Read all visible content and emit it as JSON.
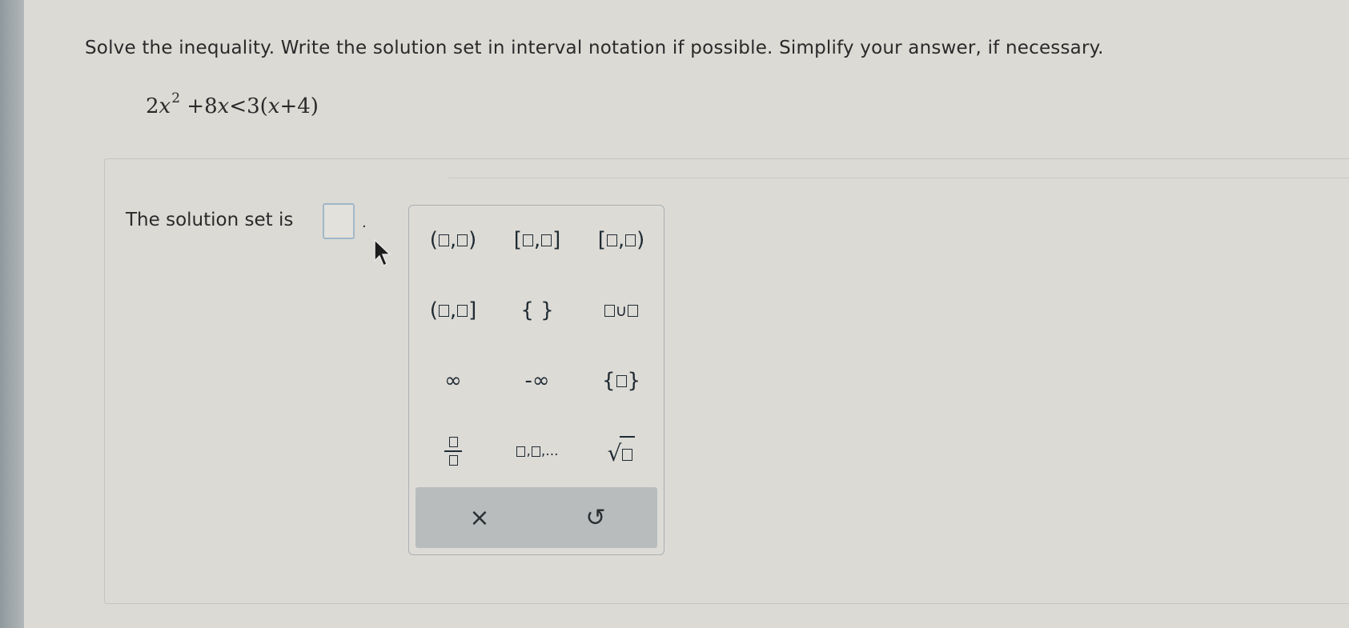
{
  "question": {
    "instruction": "Solve the inequality. Write the solution set in interval notation if possible. Simplify your answer, if necessary.",
    "equation": {
      "lhs_coef": "2",
      "var": "x",
      "exponent": "2",
      "middle": " +8",
      "middle_var": "x",
      "relation": "<3(",
      "rhs_var": "x",
      "rhs_tail": "+4)"
    }
  },
  "answer": {
    "label": "The solution set is",
    "period": ".",
    "value": ""
  },
  "palette": {
    "buttons": [
      {
        "name": "open-open-interval",
        "pre": "(",
        "mid": ",",
        "post": ")"
      },
      {
        "name": "closed-closed-interval",
        "pre": "[",
        "mid": ",",
        "post": "]"
      },
      {
        "name": "closed-open-interval",
        "pre": "[",
        "mid": ",",
        "post": ")"
      },
      {
        "name": "open-closed-interval",
        "pre": "(",
        "mid": ",",
        "post": "]"
      },
      {
        "name": "empty-set",
        "text": "{ }"
      },
      {
        "name": "union",
        "mid": "∪"
      },
      {
        "name": "infinity",
        "text": "∞"
      },
      {
        "name": "negative-infinity",
        "text": "-∞"
      },
      {
        "name": "set-braces",
        "pre": "{",
        "post": "}"
      },
      {
        "name": "fraction"
      },
      {
        "name": "list",
        "mid": ",",
        "post": ",..."
      },
      {
        "name": "square-root",
        "text": "√"
      }
    ],
    "footer": {
      "clear_icon": "close-icon",
      "clear_glyph": "×",
      "reset_icon": "undo-icon",
      "reset_glyph": "↺"
    }
  },
  "colors": {
    "background": "#dcdad5",
    "answer_box_border": "#9fb8c8",
    "palette_footer": "#b8bcbc",
    "text": "#2a2a2a"
  }
}
